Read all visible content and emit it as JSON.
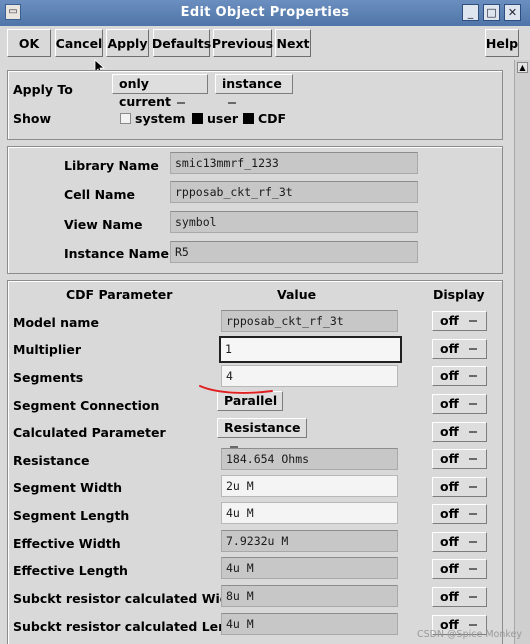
{
  "window": {
    "title": "Edit Object Properties",
    "icon": "app-menu-icon",
    "minimize_glyph": "_",
    "maximize_glyph": "□",
    "close_glyph": "✕"
  },
  "toolbar": {
    "ok": "OK",
    "cancel": "Cancel",
    "apply": "Apply",
    "defaults": "Defaults",
    "previous": "Previous",
    "next": "Next",
    "help": "Help"
  },
  "apply_section": {
    "apply_to_label": "Apply To",
    "apply_to_value": "only current",
    "scope_value": "instance",
    "show_label": "Show",
    "show_options": [
      {
        "label": "system",
        "checked": false
      },
      {
        "label": "user",
        "checked": true
      },
      {
        "label": "CDF",
        "checked": true
      }
    ]
  },
  "instance_info": {
    "library_label": "Library Name",
    "library_value": "smic13mmrf_1233",
    "cell_label": "Cell Name",
    "cell_value": "rpposab_ckt_rf_3t",
    "view_label": "View Name",
    "view_value": "symbol",
    "instance_label": "Instance Name",
    "instance_value": "R5"
  },
  "cdf": {
    "header_param": "CDF Parameter",
    "header_value": "Value",
    "header_display": "Display",
    "display_off": "off",
    "rows": [
      {
        "label": "Model name",
        "value": "rpposab_ckt_rf_3t"
      },
      {
        "label": "Multiplier",
        "value": "1"
      },
      {
        "label": "Segments",
        "value": "4"
      },
      {
        "label": "Segment Connection",
        "value": "Parallel"
      },
      {
        "label": "Calculated Parameter",
        "value": "Resistance"
      },
      {
        "label": "Resistance",
        "value": "184.654 Ohms"
      },
      {
        "label": "Segment Width",
        "value": "2u M"
      },
      {
        "label": "Segment Length",
        "value": "4u M"
      },
      {
        "label": "Effective Width",
        "value": "7.9232u M"
      },
      {
        "label": "Effective Length",
        "value": "4u M"
      },
      {
        "label": "Subckt resistor calculated Width",
        "value": "8u M"
      },
      {
        "label": "Subckt resistor calculated Length",
        "value": "4u M"
      }
    ]
  },
  "watermark": "CSDN @Spice Monkey"
}
